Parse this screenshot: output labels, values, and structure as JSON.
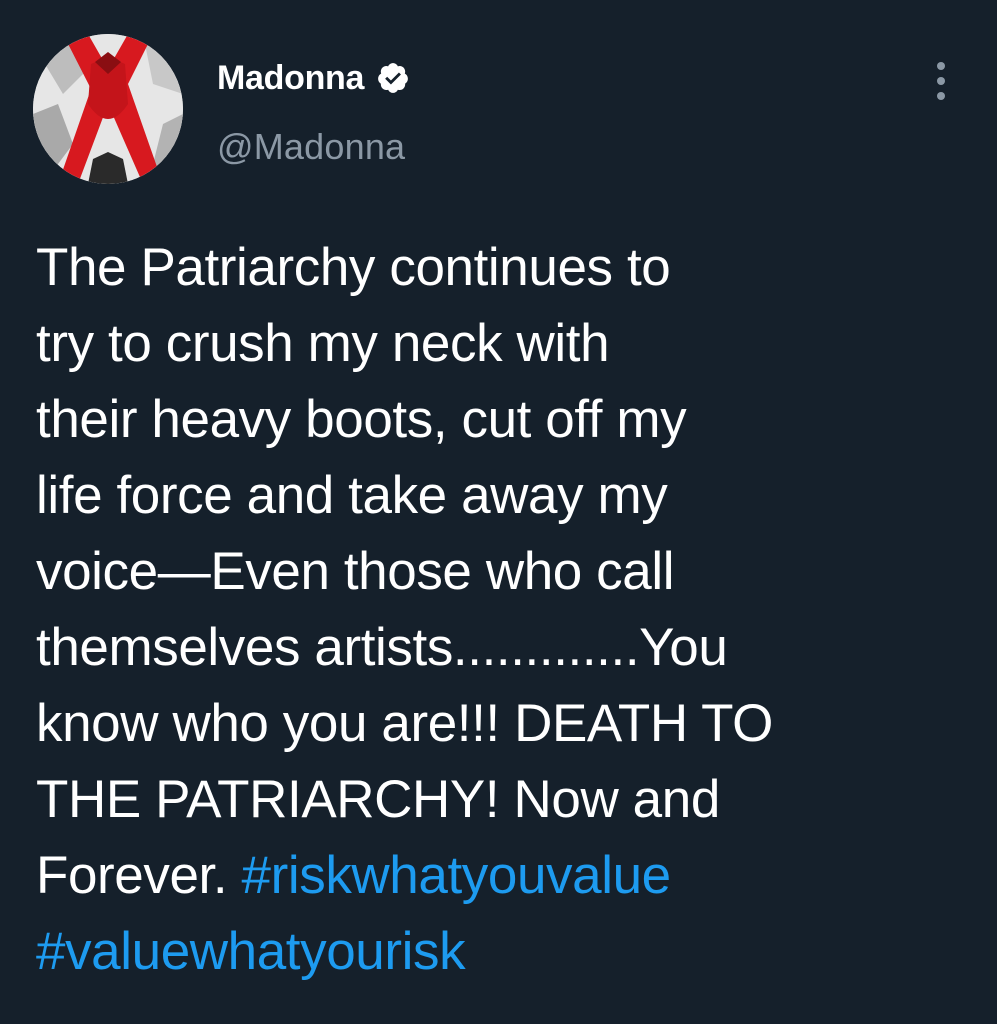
{
  "author": {
    "display_name": "Madonna",
    "handle": "@Madonna",
    "verified": true,
    "avatar_icon": "avatar-photo",
    "verified_icon": "verified-badge-icon"
  },
  "menu": {
    "more_icon": "more-options-icon"
  },
  "tweet": {
    "lines": [
      "The Patriarchy continues to",
      "try to crush my neck with",
      "their heavy boots, cut off my",
      "life force and take away my",
      "voice—Even those who call",
      "themselves artists.............You",
      "know who you are!!! DEATH TO",
      "THE PATRIARCHY! Now and"
    ],
    "last_line_prefix": "Forever. ",
    "hashtags": [
      "#riskwhatyouvalue",
      "#valuewhatyourisk"
    ]
  },
  "colors": {
    "background": "#15202b",
    "text": "#ffffff",
    "secondary_text": "#8b98a5",
    "hashtag": "#1d9bf0"
  }
}
